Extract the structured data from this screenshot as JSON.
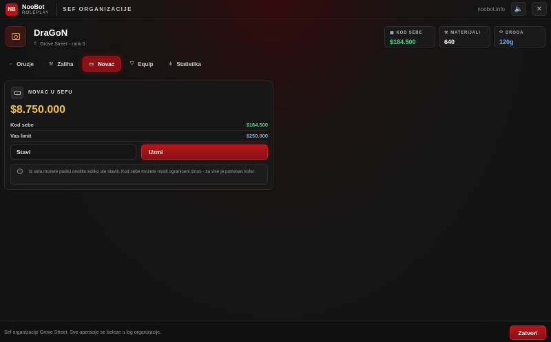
{
  "app": {
    "badge": "NB",
    "brand_name": "NooBot",
    "brand_sub": "ROLEPLAY",
    "page_title": "SEF ORGANIZACIJE",
    "site": "noobot.info",
    "sound_icon": "speaker-icon",
    "close_icon": "close-icon",
    "close_glyph": "✕",
    "sound_glyph": "🔈"
  },
  "player": {
    "name": "DraGoN",
    "location": "Grove Street - rank 5"
  },
  "stats": [
    {
      "label": "KOD SEBE",
      "value": "$184.500",
      "color": "#3ddc84",
      "icon": "wallet-icon"
    },
    {
      "label": "MATERIJALI",
      "value": "640",
      "color": "#ffffff",
      "icon": "hammer-icon"
    },
    {
      "label": "DROGA",
      "value": "120g",
      "color": "#5fb4ff",
      "icon": "pill-icon"
    }
  ],
  "tabs": [
    {
      "label": "Oruzje",
      "icon": "gun-icon",
      "glyph": "⌐",
      "active": false
    },
    {
      "label": "Zaliha",
      "icon": "wrench-icon",
      "glyph": "⚒",
      "active": false
    },
    {
      "label": "Novac",
      "icon": "cash-icon",
      "glyph": "▭",
      "active": true
    },
    {
      "label": "Equip",
      "icon": "shield-icon",
      "glyph": "⛉",
      "active": false
    },
    {
      "label": "Statistika",
      "icon": "bar-chart-icon",
      "glyph": "ılı",
      "active": false
    }
  ],
  "panel": {
    "title": "NOVAC U SEFU",
    "balance": "$8.750.000",
    "rows": [
      {
        "label": "Kod sebe",
        "value": "$184.500",
        "color": "#3ddc84"
      },
      {
        "label": "Vas limit",
        "value": "$250.000",
        "color": "#5fb4ff"
      }
    ],
    "deposit_label": "Stavi",
    "withdraw_label": "Uzmi",
    "note": "Iz sefa mozete podici onoliko koliko ste stavili. Kod sebe mozete nositi ograniceni iznos - za vise je potreban kofer."
  },
  "footer": {
    "text": "Sef organizacije Grove Street. Sve operacije se beleze u log organizacije.",
    "close_label": "Zatvori"
  },
  "colors": {
    "accent": "#b0151a",
    "gold": "#f3c23b",
    "green": "#3ddc84",
    "blue": "#5fb4ff"
  }
}
